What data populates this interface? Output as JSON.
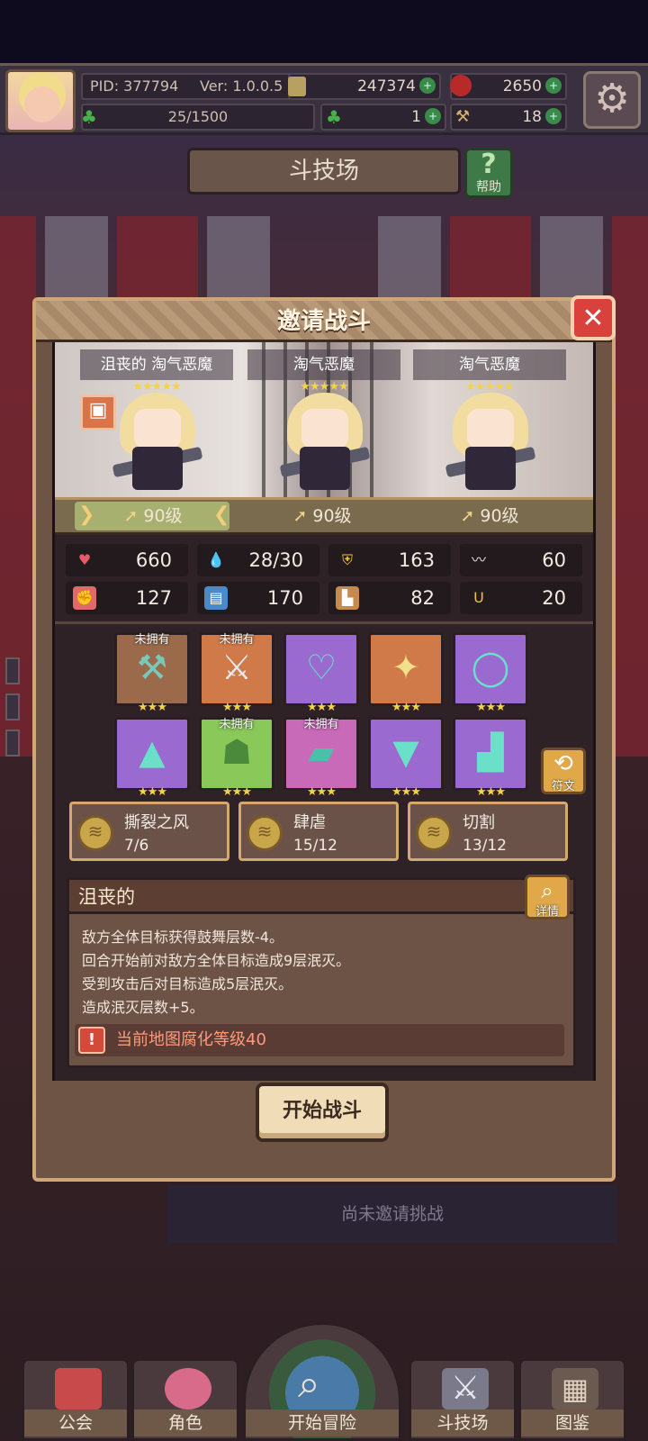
{
  "topbar": {
    "pid": "PID: 377794",
    "version": "Ver: 1.0.0.5",
    "gold": "247374",
    "gems": "2650",
    "stamina": "25/1500",
    "clover": "1",
    "hammer": "18"
  },
  "arena": {
    "title": "斗技场",
    "help_label": "帮助"
  },
  "dialog": {
    "title": "邀请战斗",
    "heroes": [
      {
        "name": "沮丧的 淘气恶魔",
        "stars": "★★★★★",
        "level": "90级"
      },
      {
        "name": "淘气恶魔",
        "stars": "★★★★★",
        "level": "90级"
      },
      {
        "name": "淘气恶魔",
        "stars": "★★★★★",
        "level": "90级"
      }
    ],
    "stats": [
      {
        "icon": "heart-icon",
        "value": "660"
      },
      {
        "icon": "water-drop-icon",
        "value": "28/30"
      },
      {
        "icon": "shield-icon",
        "value": "163"
      },
      {
        "icon": "wing-icon",
        "value": "60"
      },
      {
        "icon": "fist-icon",
        "value": "127"
      },
      {
        "icon": "book-icon",
        "value": "170"
      },
      {
        "icon": "boot-icon",
        "value": "82"
      },
      {
        "icon": "horseshoe-icon",
        "value": "20"
      }
    ],
    "equipment": [
      {
        "icon": "hammer-icon",
        "stars": "★★★",
        "unowned": "未拥有",
        "tier": "bronze"
      },
      {
        "icon": "crossed-swords-icon",
        "stars": "★★★",
        "unowned": "未拥有",
        "tier": "bronze"
      },
      {
        "icon": "amulet-icon",
        "stars": "★★★",
        "unowned": "",
        "tier": "purple"
      },
      {
        "icon": "cross-gem-icon",
        "stars": "★★★",
        "unowned": "",
        "tier": "orange"
      },
      {
        "icon": "ring-icon",
        "stars": "★★★",
        "unowned": "",
        "tier": "purple"
      },
      {
        "icon": "witch-hat-icon",
        "stars": "★★★",
        "unowned": "",
        "tier": "purple"
      },
      {
        "icon": "tunic-icon",
        "stars": "★★★",
        "unowned": "未拥有",
        "tier": "green"
      },
      {
        "icon": "gauntlet-icon",
        "stars": "★★★",
        "unowned": "未拥有",
        "tier": "purple"
      },
      {
        "icon": "belt-icon",
        "stars": "★★★",
        "unowned": "",
        "tier": "purple"
      },
      {
        "icon": "boots-icon",
        "stars": "★★★",
        "unowned": "",
        "tier": "purple"
      }
    ],
    "rune_label": "符文",
    "sets": [
      {
        "name": "撕裂之风",
        "count": "7/6"
      },
      {
        "name": "肆虐",
        "count": "15/12"
      },
      {
        "name": "切割",
        "count": "13/12"
      }
    ],
    "trait": {
      "title": "沮丧的",
      "detail_label": "详情",
      "lines": [
        "敌方全体目标获得鼓舞层数-4。",
        "回合开始前对敌方全体目标造成9层泯灭。",
        "受到攻击后对目标造成5层泯灭。",
        "造成泯灭层数+5。"
      ],
      "warning": "当前地图腐化等级40"
    },
    "start_label": "开始战斗"
  },
  "background": {
    "no_challenge": "尚未邀请挑战"
  },
  "nav": {
    "guild": "公会",
    "character": "角色",
    "adventure": "开始冒险",
    "arena": "斗技场",
    "codex": "图鉴"
  },
  "colors": {
    "accent_gold": "#cfa776",
    "close_red": "#d8413c",
    "star": "#f4d24a",
    "warning": "#ff9a7a"
  }
}
